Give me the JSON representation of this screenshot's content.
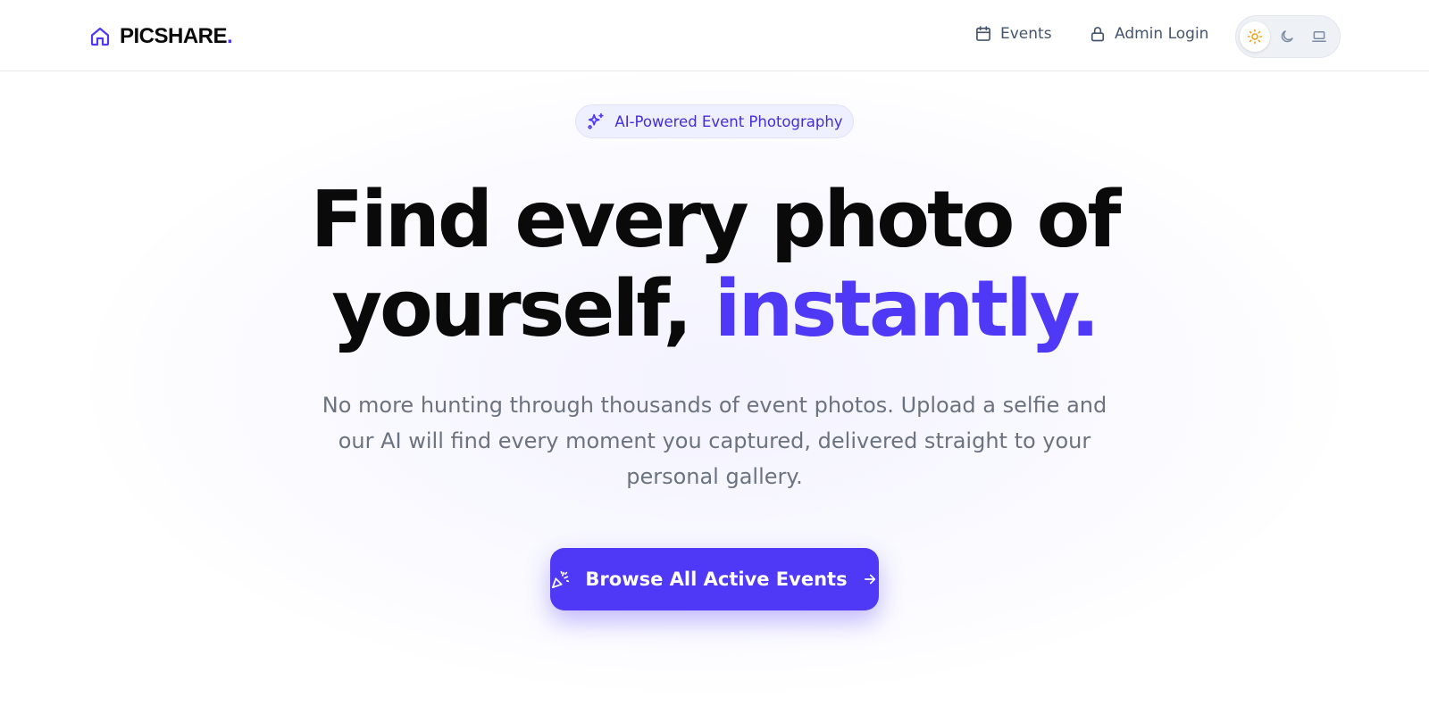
{
  "header": {
    "brand_name": "PICSHARE",
    "brand_dot": ".",
    "brand_icon": "home-icon",
    "nav": {
      "events_label": "Events",
      "events_icon": "calendar-icon",
      "admin_label": "Admin Login",
      "admin_icon": "lock-icon"
    },
    "theme_toggle": {
      "options": [
        "light",
        "dark",
        "system"
      ],
      "icons": [
        "sun-icon",
        "moon-icon",
        "laptop-icon"
      ],
      "selected": "light"
    }
  },
  "hero": {
    "badge_icon": "sparkles-icon",
    "badge_text": "AI-Powered Event Photography",
    "headline_part1": "Find every photo of yourself,",
    "headline_accent": "instantly.",
    "subtitle": "No more hunting through thousands of event photos. Upload a selfie and our AI will find every moment you captured, delivered straight to your personal gallery.",
    "cta_label": "Browse All Active Events",
    "cta_icon": "party-popper-icon",
    "cta_arrow_icon": "arrow-right-icon"
  },
  "colors": {
    "accent": "#4f39f6",
    "badge_text": "#432dd7",
    "nav_text": "#45556c",
    "sun_active": "#f59e0b",
    "headline": "#0a0a0a",
    "subtitle": "#6b7280"
  }
}
